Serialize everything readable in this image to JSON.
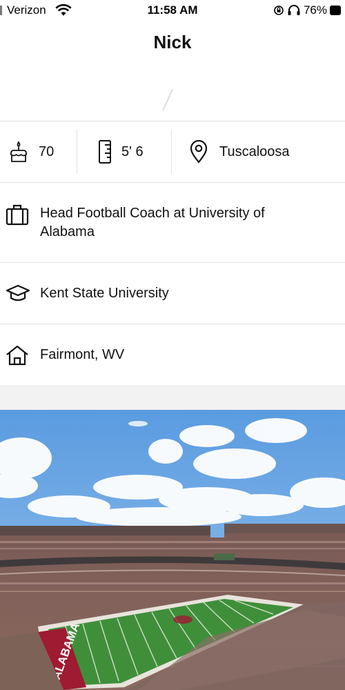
{
  "status_bar": {
    "carrier": "Verizon",
    "time": "11:58 AM",
    "battery": "76%"
  },
  "profile": {
    "name": "Nick"
  },
  "stats": {
    "age": "70",
    "height": "5' 6",
    "location": "Tuscaloosa"
  },
  "details": {
    "job": "Head Football Coach at University of Alabama",
    "school": "Kent State University",
    "hometown": "Fairmont, WV"
  },
  "photo": {
    "end_zone_text": "ALABAMA"
  },
  "icons": {
    "age": "cake-icon",
    "height": "ruler-icon",
    "location": "location-pin-icon",
    "job": "briefcase-icon",
    "school": "graduation-cap-icon",
    "hometown": "house-icon"
  },
  "colors": {
    "background": "#f2f2f2",
    "card": "#ffffff",
    "divider": "#e2e2e2",
    "text": "#111111",
    "field_green": "#3f8f3a",
    "crimson": "#9e1b32"
  }
}
